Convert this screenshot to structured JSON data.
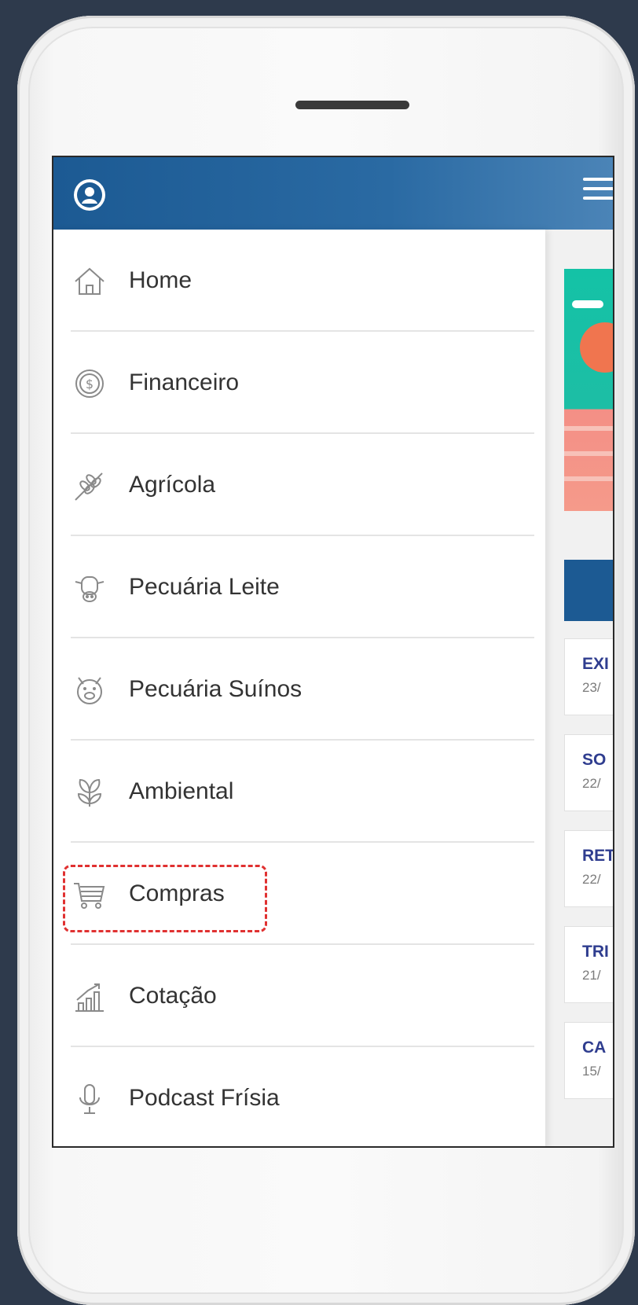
{
  "menu": {
    "items": [
      {
        "label": "Home",
        "icon": "home-icon"
      },
      {
        "label": "Financeiro",
        "icon": "dollar-coin-icon"
      },
      {
        "label": "Agrícola",
        "icon": "wheat-icon"
      },
      {
        "label": "Pecuária Leite",
        "icon": "cow-icon"
      },
      {
        "label": "Pecuária Suínos",
        "icon": "pig-icon"
      },
      {
        "label": "Ambiental",
        "icon": "leaves-icon"
      },
      {
        "label": "Compras",
        "icon": "cart-icon"
      },
      {
        "label": "Cotação",
        "icon": "chart-growth-icon"
      },
      {
        "label": "Podcast Frísia",
        "icon": "microphone-icon"
      }
    ]
  },
  "news": [
    {
      "title": "EXI",
      "date": "23/"
    },
    {
      "title": "SO",
      "date": "22/"
    },
    {
      "title": "RET",
      "date": "22/"
    },
    {
      "title": "TRI",
      "date": "21/"
    },
    {
      "title": "CA",
      "date": "15/"
    }
  ],
  "colors": {
    "header": "#1c5a93",
    "highlight": "#e03131",
    "news_title": "#2f3d8f"
  }
}
